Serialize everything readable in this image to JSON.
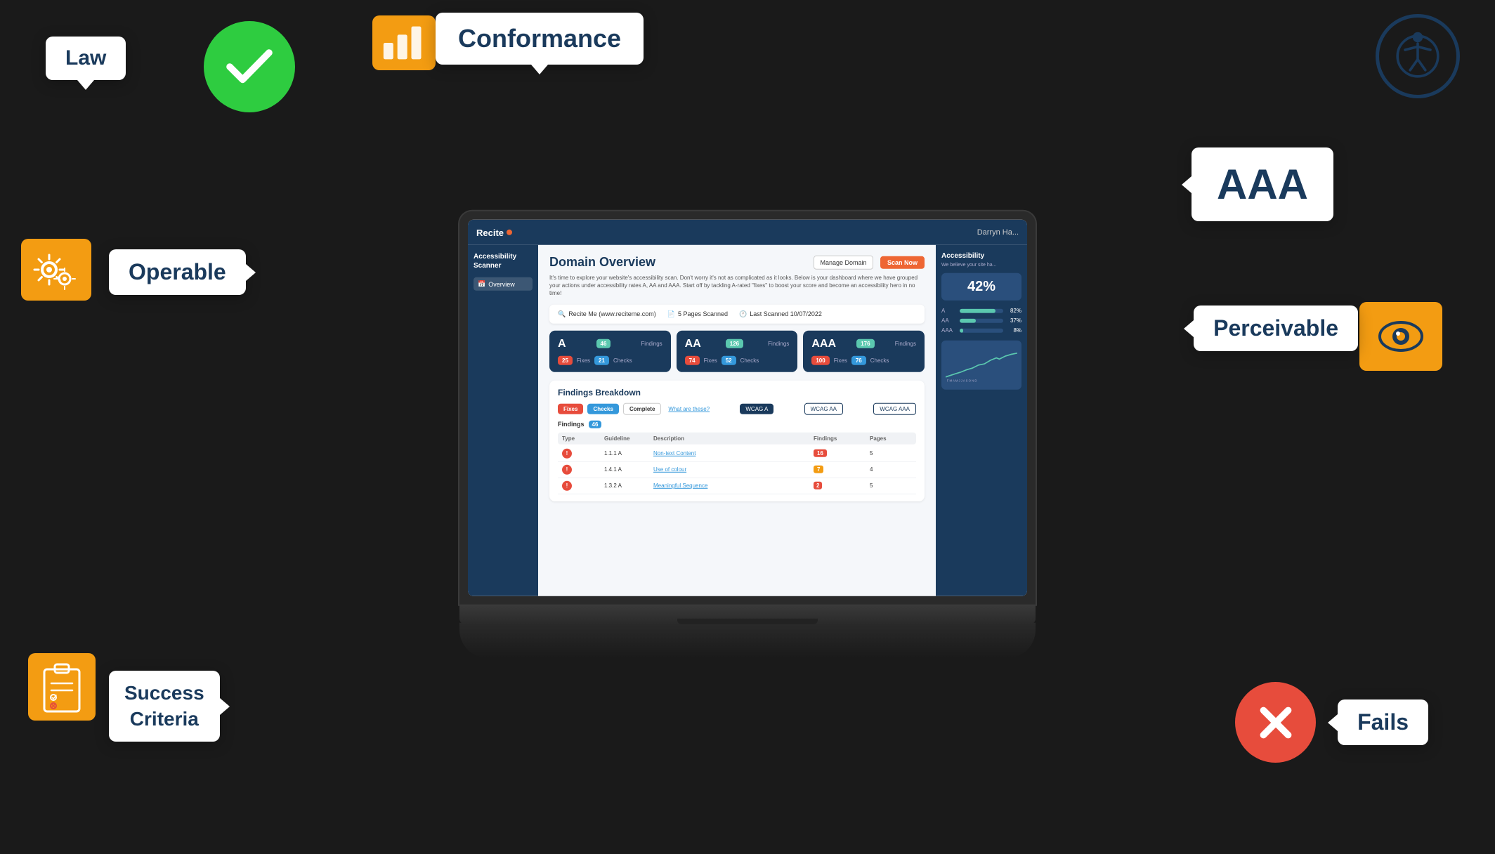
{
  "app": {
    "logo": "Recite",
    "user": "Darryn Ha...",
    "header_buttons": {
      "manage": "Manage Domain",
      "scan": "Scan Now"
    },
    "sidebar": {
      "title": "Accessibility Scanner",
      "nav_items": [
        {
          "label": "Overview",
          "active": true
        }
      ]
    },
    "main": {
      "title": "Domain Overview",
      "description": "It's time to explore your website's accessibility scan. Don't worry it's not as complicated as it looks. Below is your dashboard where we have grouped your actions under accessibility rates A, AA and AAA. Start off by tackling A-rated \"fixes\" to boost your score and become an accessibility hero in no time!",
      "scan_info": {
        "site": "Recite Me (www.reciteme.com)",
        "pages_scanned": "5 Pages Scanned",
        "last_scanned": "Last Scanned 10/07/2022"
      },
      "cards": [
        {
          "level": "A",
          "findings": "46",
          "fixes": "25",
          "checks": "21"
        },
        {
          "level": "AA",
          "findings": "126",
          "fixes": "74",
          "checks": "52"
        },
        {
          "level": "AAA",
          "findings": "176",
          "fixes": "100",
          "checks": "76"
        }
      ],
      "findings_breakdown": {
        "title": "Findings Breakdown",
        "filter_buttons": [
          "Fixes",
          "Checks",
          "Complete"
        ],
        "what_label": "What are these?",
        "wcag_buttons": [
          "WCAG A",
          "WCAG AA",
          "WCAG AAA"
        ],
        "findings_count": "46",
        "table_headers": [
          "Type",
          "Guideline",
          "Description",
          "Findings",
          "Pages"
        ],
        "table_rows": [
          {
            "type": "error",
            "guideline": "1.1.1 A",
            "description": "Non-text Content",
            "findings": "16",
            "pages": "5",
            "badge_color": "red"
          },
          {
            "type": "error",
            "guideline": "1.4.1 A",
            "description": "Use of colour",
            "findings": "7",
            "pages": "4",
            "badge_color": "orange"
          },
          {
            "type": "error",
            "guideline": "1.3.2 A",
            "description": "Meaningful Sequence",
            "findings": "2",
            "pages": "5",
            "badge_color": "red"
          }
        ]
      }
    },
    "right_panel": {
      "title": "Accessibility",
      "subtitle": "We believe your site ha...",
      "percent": "42%",
      "levels": [
        {
          "label": "A",
          "value": 82,
          "display": "82%"
        },
        {
          "label": "AA",
          "value": 37,
          "display": "37%"
        },
        {
          "label": "AAA",
          "value": 8,
          "display": "8%"
        }
      ]
    }
  },
  "floating_labels": {
    "law": "Law",
    "conformance": "Conformance",
    "operable": "Operable",
    "perceivable": "Perceivable",
    "success_criteria": "Success\nCriteria",
    "fails": "Fails",
    "aaa": "AAA"
  }
}
